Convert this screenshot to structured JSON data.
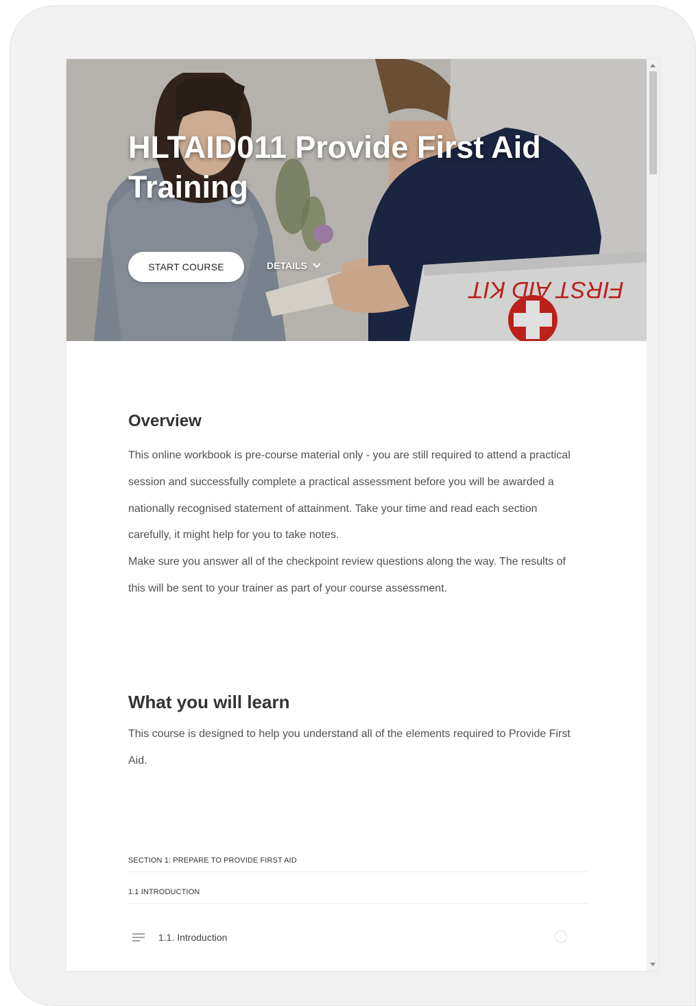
{
  "hero": {
    "title": "HLTAID011 Provide First Aid Training",
    "start_button": "START COURSE",
    "details_label": "DETAILS",
    "kit_label": "FIRST AID KIT"
  },
  "overview": {
    "title": "Overview",
    "paragraph": "This online workbook is pre-course material only - you are still required to attend a practical session and successfully complete a practical assessment before you will be awarded a nationally recognised statement of attainment. Take your time and read each section carefully, it might help for you to take notes.",
    "paragraph2": "Make sure you answer all of the checkpoint review questions along the way. The results of this will be sent to your trainer as part of your course assessment."
  },
  "learn": {
    "title": "What you will learn",
    "paragraph": "This course is designed to help you understand all of the elements required to Provide First Aid."
  },
  "outline": {
    "section": "SECTION 1: PREPARE TO PROVIDE FIRST AID",
    "subsection": "1.1 INTRODUCTION",
    "lesson": "1.1. Introduction"
  },
  "colors": {
    "accent_red": "#d4261f",
    "tablet_frame": "#f1f1f1"
  }
}
